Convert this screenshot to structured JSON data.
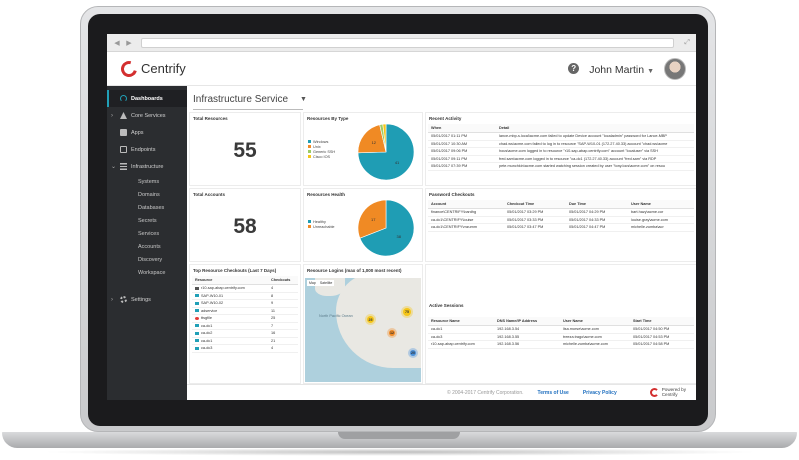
{
  "header": {
    "logo_text": "Centrify",
    "user_name": "John Martin"
  },
  "sidebar": {
    "items": [
      {
        "label": "Dashboards",
        "icon": "dashboard-icon",
        "active": true
      },
      {
        "label": "Core Services",
        "icon": "core-services-icon"
      },
      {
        "label": "Apps",
        "icon": "apps-icon"
      },
      {
        "label": "Endpoints",
        "icon": "endpoints-icon"
      },
      {
        "label": "Infrastructure",
        "icon": "infrastructure-icon"
      }
    ],
    "infra_subitems": [
      "Systems",
      "Domains",
      "Databases",
      "Secrets",
      "Services",
      "Accounts",
      "Discovery",
      "Workspace"
    ],
    "settings_label": "Settings"
  },
  "page": {
    "title": "Infrastructure Service"
  },
  "widgets": {
    "total_resources": {
      "title": "Total Resources",
      "value": "55"
    },
    "total_accounts": {
      "title": "Total Accounts",
      "value": "58"
    },
    "resources_by_type": {
      "title": "Resources By Type",
      "legend": [
        "Windows",
        "Unix",
        "Generic SSH",
        "Cisco IOS"
      ],
      "slices": [
        {
          "label": "Windows",
          "value": 41,
          "color": "#1f9db4"
        },
        {
          "label": "Unix",
          "value": 12,
          "color": "#f08a24"
        },
        {
          "label": "Generic SSH",
          "value": 1,
          "color": "#9ccc65"
        },
        {
          "label": "Cisco IOS",
          "value": 1,
          "color": "#f5c518"
        }
      ],
      "slice_labels": [
        "41",
        "12"
      ]
    },
    "resources_health": {
      "title": "Resources Health",
      "legend": [
        "Healthy",
        "Unreachable"
      ],
      "slices": [
        {
          "label": "Healthy",
          "value": 38,
          "color": "#1f9db4"
        },
        {
          "label": "Unreachable",
          "value": 17,
          "color": "#f08a24"
        }
      ],
      "slice_labels": [
        "38",
        "17"
      ]
    },
    "top_checkouts": {
      "title": "Top Resource Checkouts (Last 7 Days)",
      "columns": [
        "Resource",
        "Checkouts"
      ],
      "rows": [
        {
          "icon": "dark",
          "resource": "r10-sap-abap.centrify.com",
          "count": "4"
        },
        {
          "icon": "teal",
          "resource": "SAP-W10-01",
          "count": "8"
        },
        {
          "icon": "teal",
          "resource": "SAP-W10-02",
          "count": "9"
        },
        {
          "icon": "teal",
          "resource": "adservice",
          "count": "11"
        },
        {
          "icon": "red",
          "resource": "ttsgfile",
          "count": "25"
        },
        {
          "icon": "teal",
          "resource": "ca-dc1",
          "count": "7"
        },
        {
          "icon": "teal",
          "resource": "ca-dc2",
          "count": "16"
        },
        {
          "icon": "teal",
          "resource": "ca-dc1",
          "count": "21"
        },
        {
          "icon": "teal",
          "resource": "ca-dc3",
          "count": "4"
        }
      ]
    },
    "resource_logins": {
      "title": "Resource Logins (max of 1,000 most recent)",
      "map_tabs": [
        "Map",
        "Satellite"
      ],
      "map_labels": [
        "North Pacific Ocean"
      ],
      "clusters": [
        "75",
        "25",
        "12",
        "20"
      ]
    },
    "recent_activity": {
      "title": "Recent Activity",
      "columns": [
        "When",
        "Detail"
      ],
      "rows": [
        {
          "when": "05/01/2017 01:11 PM",
          "detail": "lance-mbp-s.local\\acme.com failed to update Device account \"localadmin\" password for Lance-MBP"
        },
        {
          "when": "05/01/2017 10:30 AM",
          "detail": "chad.ws\\acme.com failed to log in to resource \"SAP-W10-01 (172.27.40.33) account \"chad.ws\\acme"
        },
        {
          "when": "05/01/2017 09:06 PM",
          "detail": "hous\\acme.com logged in to resource \"r10-sap-abap.centrify.com\" account \"localuser\" via SSH"
        },
        {
          "when": "05/01/2017 09:11 PM",
          "detail": "fred.sam\\acme.com logged in to resource \"ca-dc1 (172.27.40.33) account \"fred.sam\" via RDP"
        },
        {
          "when": "05/01/2017 07:39 PM",
          "detail": "pete.munchkin\\acme.com started watching session created by user \"tony.locs\\acme.com\" on resou"
        }
      ]
    },
    "password_checkouts": {
      "title": "Password Checkouts",
      "columns": [
        "Account",
        "Checkout Time",
        "Due Time",
        "User Name"
      ],
      "rows": [
        {
          "account": "finance\\CENTRIFY\\bardhg",
          "checkout": "05/01/2017 03:29 PM",
          "due": "05/01/2017 04:29 PM",
          "user": "bart.hazy\\acme.cor"
        },
        {
          "account": "ca-dc1\\CENTRIFY\\louise",
          "checkout": "05/01/2017 03:33 PM",
          "due": "05/01/2017 04:33 PM",
          "user": "louise.gray\\acme.com"
        },
        {
          "account": "ca-dc1\\CENTRIFY\\mzumm",
          "checkout": "05/01/2017 03:47 PM",
          "due": "05/01/2017 04:47 PM",
          "user": "michelle.zumba\\acr"
        }
      ]
    },
    "active_sessions": {
      "title": "Active Sessions",
      "columns": [
        "Resource Name",
        "DNS Name/IP Address",
        "User Name",
        "Start Time"
      ],
      "rows": [
        {
          "name": "ca-dc1",
          "ip": "192.168.3.54",
          "user": "lisa.morse\\acme.com",
          "start": "05/01/2017 04:50 PM"
        },
        {
          "name": "ca-dc3",
          "ip": "192.168.3.55",
          "user": "treeza.trago\\acme.com",
          "start": "05/01/2017 04:53 PM"
        },
        {
          "name": "r10-sap-abap.centrify.com",
          "ip": "192.168.3.56",
          "user": "michelle.zumba\\acme.com",
          "start": "05/01/2017 04:58 PM"
        }
      ]
    }
  },
  "footer": {
    "copyright": "© 2004-2017 Centrify Corporation.",
    "terms": "Terms of Use",
    "privacy": "Privacy Policy",
    "powered_line1": "Powered by",
    "powered_line2": "Centrify"
  }
}
